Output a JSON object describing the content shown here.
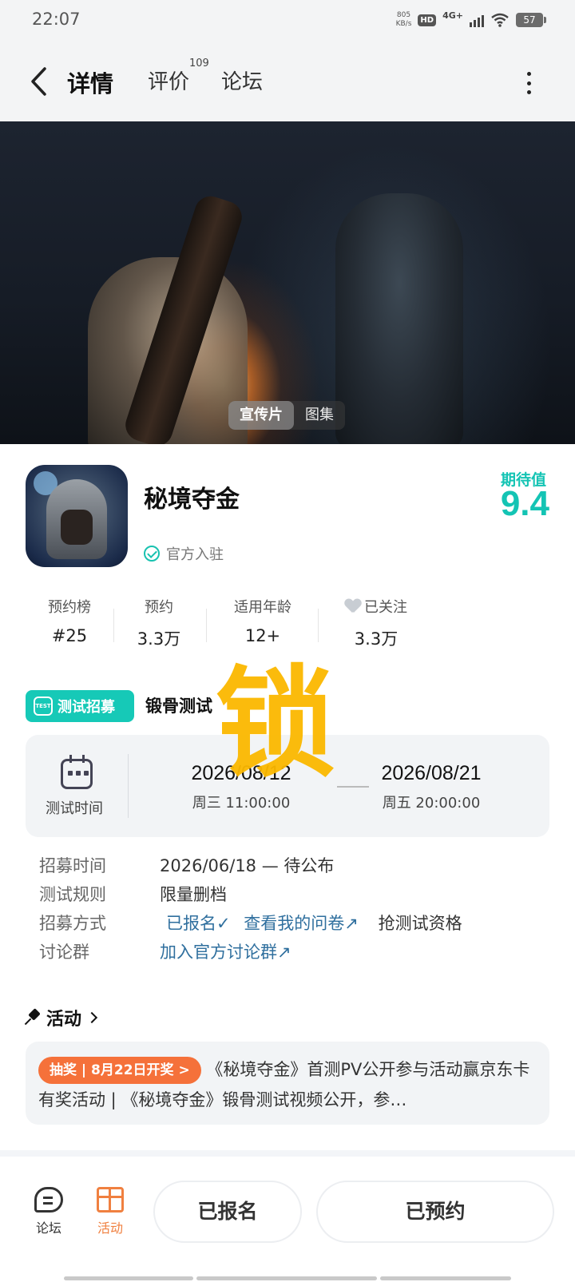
{
  "status": {
    "time": "22:07",
    "net_speed_value": "805",
    "net_speed_unit": "KB/s",
    "hd": "HD",
    "network": "4G+",
    "battery": "57"
  },
  "nav": {
    "tab_detail": "详情",
    "tab_review": "评价",
    "review_count": "109",
    "tab_forum": "论坛"
  },
  "banner": {
    "tab_video": "宣传片",
    "tab_gallery": "图集"
  },
  "game": {
    "title": "秘境夺金",
    "official": "官方入驻",
    "expect_label": "期待值",
    "expect_value": "9.4"
  },
  "stats": [
    {
      "label": "预约榜",
      "value": "#25"
    },
    {
      "label": "预约",
      "value": "3.3万"
    },
    {
      "label": "适用年龄",
      "value": "12+"
    },
    {
      "label": "已关注",
      "value": "3.3万"
    }
  ],
  "test": {
    "badge": "测试招募",
    "badge_icon_text": "TEST",
    "name": "锻骨测试",
    "watermark": "锁",
    "time_label": "测试时间",
    "start_date": "2026/08/12",
    "start_time": "周三  11:00:00",
    "end_date": "2026/08/21",
    "end_time": "周五  20:00:00"
  },
  "info": {
    "recruit_label": "招募时间",
    "recruit_value": "2026/06/18 — 待公布",
    "rule_label": "测试规则",
    "rule_value": "限量删档",
    "method_label": "招募方式",
    "method_signed": "已报名✓",
    "method_survey": "查看我的问卷↗",
    "method_grab": "抢测试资格",
    "group_label": "讨论群",
    "group_value": "加入官方讨论群↗"
  },
  "activity": {
    "title": "活动",
    "pill": "抽奖 | 8月22日开奖 >",
    "text": "《秘境夺金》首测PV公开参与活动赢京东卡 有奖活动 | 《秘境夺金》锻骨测试视频公开，参…"
  },
  "bottom": {
    "forum": "论坛",
    "activity": "活动",
    "signed": "已报名",
    "reserved": "已预约"
  },
  "colors": {
    "accent": "#16c9b7",
    "link": "#2f6f9e",
    "orange": "#f5713a",
    "watermark": "#fbb800"
  }
}
